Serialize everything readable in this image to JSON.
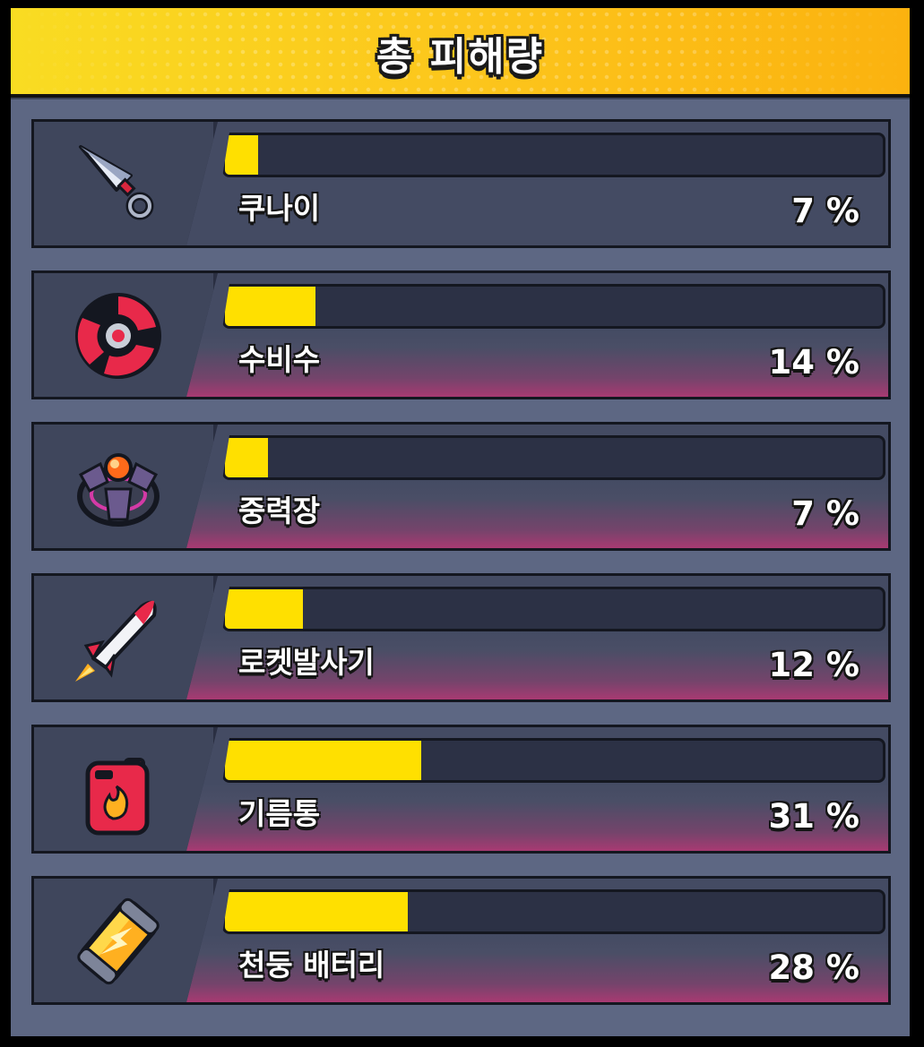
{
  "title": "총 피해량",
  "rows": [
    {
      "name": "쿠나이",
      "pct_label": "7 %",
      "fill_fraction": 0.05,
      "icon": "kunai-icon",
      "highlight": false
    },
    {
      "name": "수비수",
      "pct_label": "14 %",
      "fill_fraction": 0.137,
      "icon": "guardian-icon",
      "highlight": true
    },
    {
      "name": "중력장",
      "pct_label": "7 %",
      "fill_fraction": 0.066,
      "icon": "gravity-field-icon",
      "highlight": true
    },
    {
      "name": "로켓발사기",
      "pct_label": "12 %",
      "fill_fraction": 0.118,
      "icon": "rocket-launcher-icon",
      "highlight": true
    },
    {
      "name": "기름통",
      "pct_label": "31 %",
      "fill_fraction": 0.298,
      "icon": "fuel-can-icon",
      "highlight": true
    },
    {
      "name": "천둥 배터리",
      "pct_label": "28 %",
      "fill_fraction": 0.278,
      "icon": "thunder-battery-icon",
      "highlight": true
    }
  ],
  "colors": {
    "bar_fill": "#ffe000",
    "header_yellow": "#fcc61c",
    "row_highlight_pink": "#a83a72"
  }
}
